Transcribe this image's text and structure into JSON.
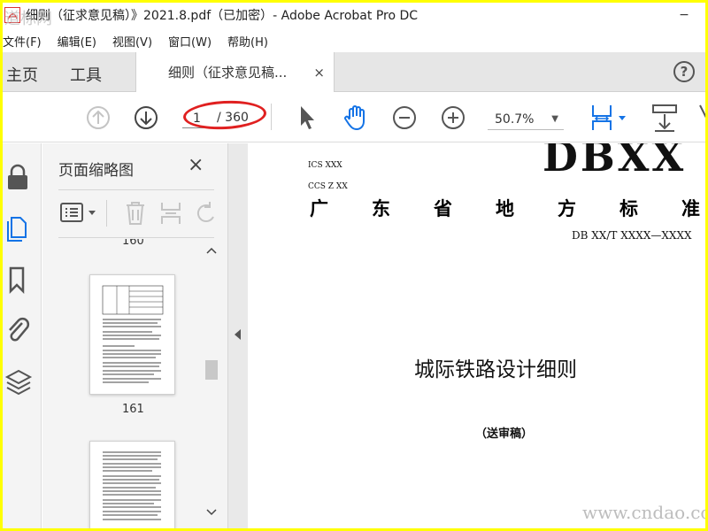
{
  "window": {
    "title": "细则（征求意见稿）》2021.8.pdf（已加密）- Adobe Acrobat Pro DC",
    "minimize_glyph": "−"
  },
  "menu": [
    "文件(F)",
    "编辑(E)",
    "视图(V)",
    "窗口(W)",
    "帮助(H)"
  ],
  "tabs": {
    "home": "主页",
    "tools": "工具",
    "document": "细则（征求意见稿...",
    "close_glyph": "×",
    "help_glyph": "?"
  },
  "toolbar": {
    "page_current": "1",
    "page_total": "/ 360",
    "zoom": "50.7%"
  },
  "thumbnails": {
    "title": "页面缩略图",
    "close_glyph": "×",
    "label_prev": "160",
    "label_current": "161"
  },
  "document": {
    "ics": "ICS  XXX",
    "ccs": "CCS Z XX",
    "logo": "DBXX",
    "standard_chars": [
      "广",
      "东",
      "省",
      "地",
      "方",
      "标",
      "准"
    ],
    "code": "DB XX/T XXXX—XXXX",
    "title": "城际铁路设计细则",
    "subtitle": "（送审稿）"
  },
  "watermarks": {
    "top_left": "道标网",
    "bottom_right": "www.cndao.com"
  },
  "colors": {
    "frame": "#ffff00",
    "accent_blue": "#1473e6",
    "annotation_red": "#e02020"
  }
}
